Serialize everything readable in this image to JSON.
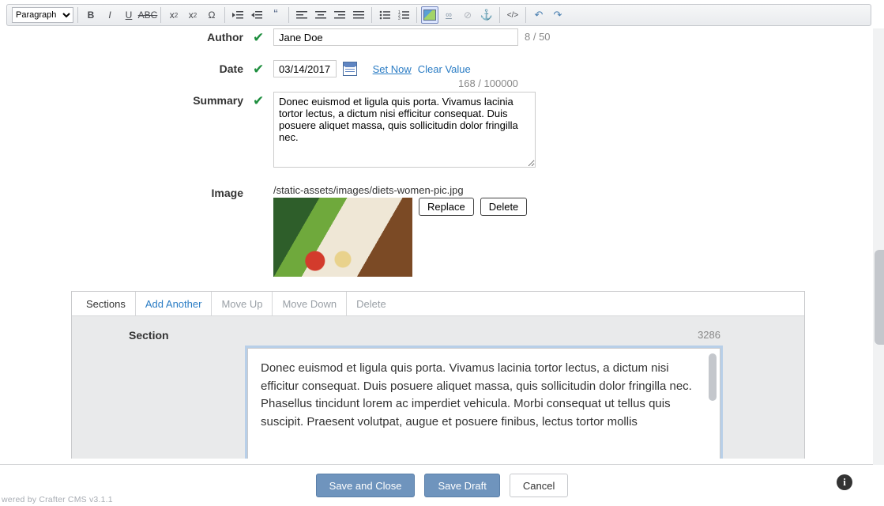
{
  "toolbar": {
    "format_options": [
      "Paragraph"
    ],
    "format_selected": "Paragraph"
  },
  "fields": {
    "author": {
      "label": "Author",
      "value": "Jane Doe",
      "counter": "8 / 50"
    },
    "date": {
      "label": "Date",
      "value": "03/14/2017",
      "set_now": "Set Now",
      "clear": "Clear Value"
    },
    "summary": {
      "label": "Summary",
      "counter": "168 / 100000",
      "value": "Donec euismod et ligula quis porta. Vivamus lacinia tortor lectus, a dictum nisi efficitur consequat. Duis posuere aliquet massa, quis sollicitudin dolor fringilla nec."
    },
    "image": {
      "label": "Image",
      "path": "/static-assets/images/diets-women-pic.jpg",
      "replace": "Replace",
      "delete": "Delete"
    }
  },
  "sections": {
    "tabs": {
      "title": "Sections",
      "add": "Add Another",
      "up": "Move Up",
      "down": "Move Down",
      "del": "Delete"
    },
    "section_label": "Section",
    "section_count": "3286",
    "section_body": "Donec euismod et ligula quis porta. Vivamus lacinia tortor lectus, a dictum nisi efficitur consequat. Duis posuere aliquet massa, quis sollicitudin dolor fringilla nec. Phasellus tincidunt lorem ac imperdiet vehicula. Morbi consequat ut tellus quis suscipit. Praesent volutpat, augue et posuere finibus, lectus tortor mollis"
  },
  "actions": {
    "save_close": "Save and Close",
    "save_draft": "Save Draft",
    "cancel": "Cancel"
  },
  "footer": "wered by Crafter CMS v3.1.1"
}
